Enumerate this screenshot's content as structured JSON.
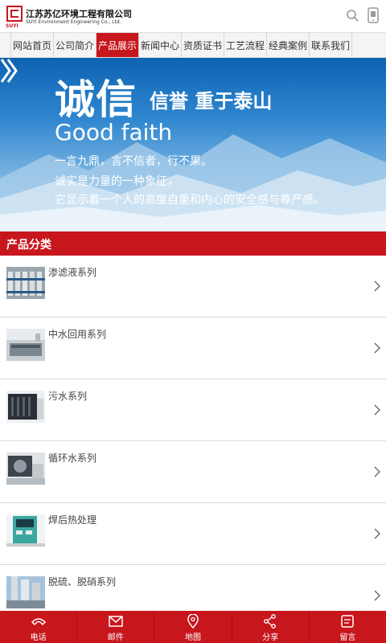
{
  "header": {
    "logo_mark": "SUYI",
    "company_cn": "江苏苏亿环境工程有限公司",
    "company_en": "SUYI Environment Engineering Co., Ltd.",
    "search_icon": "search-icon",
    "phone_icon": "mobile-phone-icon"
  },
  "nav": {
    "items": [
      {
        "label": "网站首页"
      },
      {
        "label": "公司简介"
      },
      {
        "label": "产品展示",
        "active": true
      },
      {
        "label": "新闻中心"
      },
      {
        "label": "资质证书"
      },
      {
        "label": "工艺流程"
      },
      {
        "label": "经典案例"
      },
      {
        "label": "联系我们"
      }
    ]
  },
  "banner": {
    "big_text": "诚信",
    "slogan": "信誉 重于泰山",
    "english": "Good faith",
    "line1": "一言九鼎，言不信者，行不果。",
    "line2": "诚实是力量的一种象征，",
    "line3": "它显示着一个人的高度自重和内心的安全感与尊严感。"
  },
  "category": {
    "title": "产品分类",
    "items": [
      {
        "label": "渗滤液系列"
      },
      {
        "label": "中水回用系列"
      },
      {
        "label": "污水系列"
      },
      {
        "label": "循环水系列"
      },
      {
        "label": "焊后热处理"
      },
      {
        "label": "脱硫、脱硝系列"
      }
    ]
  },
  "footer": {
    "items": [
      {
        "label": "电话",
        "icon": "phone-icon"
      },
      {
        "label": "邮件",
        "icon": "mail-icon"
      },
      {
        "label": "地图",
        "icon": "map-pin-icon"
      },
      {
        "label": "分享",
        "icon": "share-icon"
      },
      {
        "label": "留言",
        "icon": "message-icon"
      }
    ]
  },
  "colors": {
    "accent": "#c8161d",
    "banner_blue": "#1a6fbe"
  }
}
